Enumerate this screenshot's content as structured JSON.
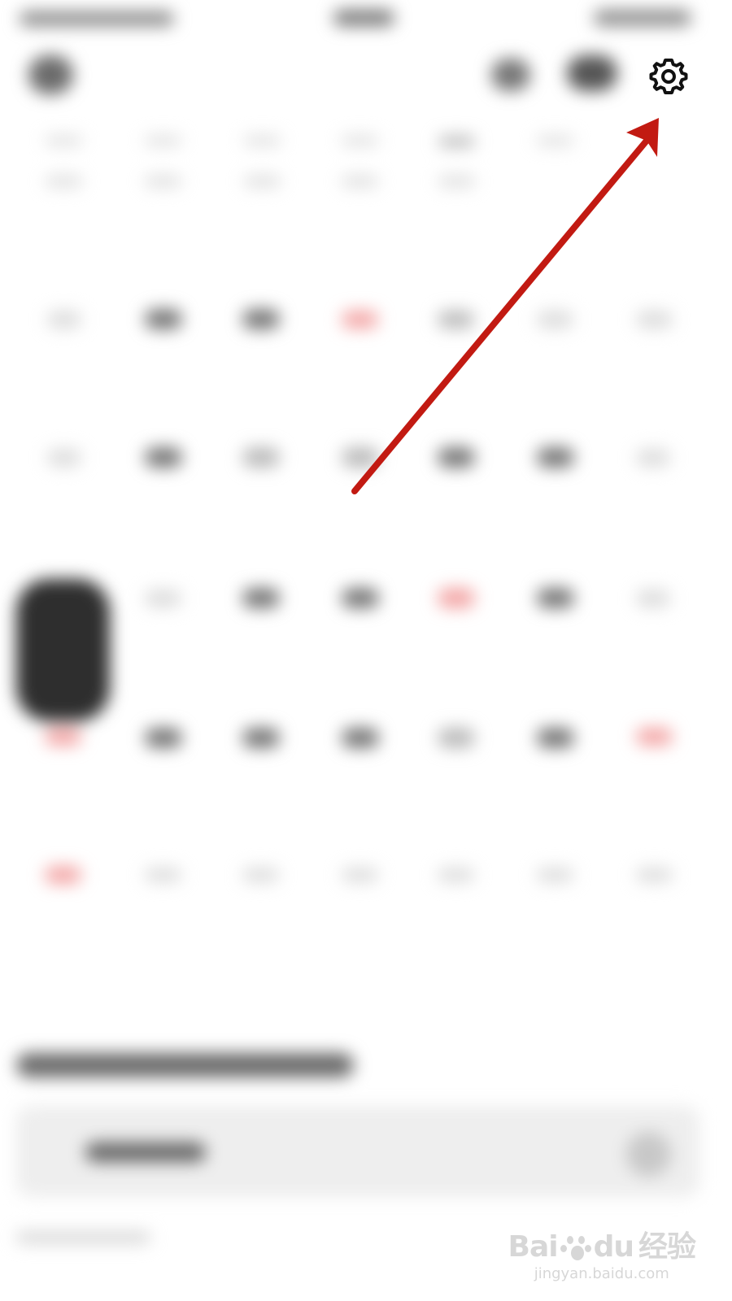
{
  "settings_button": {
    "icon": "settings-icon"
  },
  "annotation": {
    "arrow_color": "#c21a12",
    "target": "settings-icon"
  },
  "watermark": {
    "brand_left": "Bai",
    "brand_middle": "du",
    "brand_right": "经验",
    "domain": "jingyan.baidu.com"
  },
  "colors": {
    "arrow_red": "#c21a12",
    "blurred_content": "#707070",
    "date_red": "#e43b3b"
  }
}
